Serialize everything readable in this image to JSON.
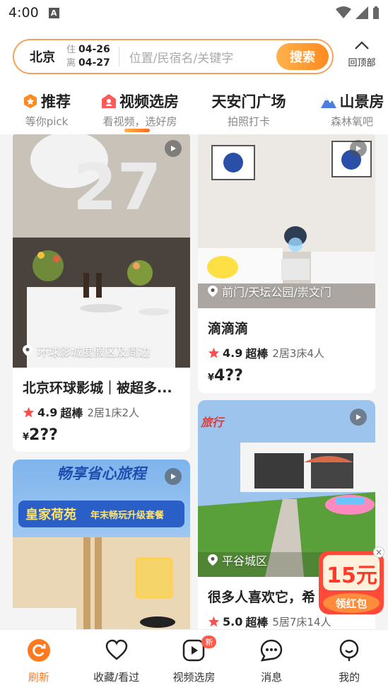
{
  "status_bar": {
    "time": "4:00",
    "notification_icon": "A"
  },
  "search": {
    "city": "北京",
    "checkin_label": "住",
    "checkin_date": "04-26",
    "checkout_label": "离",
    "checkout_date": "04-27",
    "placeholder": "位置/民宿名/关键字",
    "button_label": "搜索",
    "back_top_label": "回顶部"
  },
  "tabs": [
    {
      "title": "推荐",
      "subtitle": "等你pick",
      "icon": "star-badge-icon"
    },
    {
      "title": "视频选房",
      "subtitle": "看视频，选好房",
      "icon": "house-icon",
      "active": true
    },
    {
      "title": "天安门广场",
      "subtitle": "拍照打卡"
    },
    {
      "title": "山景房",
      "subtitle": "森林氧吧",
      "icon": "mountain-icon"
    }
  ],
  "listings": [
    {
      "location": "环球影城度假区及周边",
      "title": "北京环球影城｜被超多...",
      "score": "4.9",
      "level": "超棒",
      "rooms": "2居1床2人",
      "currency": "¥",
      "price": "2??"
    },
    {
      "location": "前门/天坛公园/崇文门",
      "title": "滴滴滴",
      "score": "4.9",
      "level": "超棒",
      "rooms": "2居3床4人",
      "currency": "¥",
      "price": "4??"
    },
    {
      "banner_title": "畅享省心旅程",
      "banner_brand": "皇家荷苑",
      "banner_tag": "年末畅玩升级套餐"
    },
    {
      "location": "平谷城区",
      "title": "很多人喜欢它，希",
      "score": "5.0",
      "level": "超棒",
      "rooms": "5居7床14人",
      "overlay_text": "旅行"
    }
  ],
  "red_packet": {
    "amount": "15元",
    "label": "领红包"
  },
  "bottom_nav": [
    {
      "label": "刷新",
      "icon": "refresh-icon",
      "active": true
    },
    {
      "label": "收藏/看过",
      "icon": "heart-icon"
    },
    {
      "label": "视频选房",
      "icon": "video-icon",
      "badge": "新"
    },
    {
      "label": "消息",
      "icon": "message-icon"
    },
    {
      "label": "我的",
      "icon": "profile-icon"
    }
  ],
  "colors": {
    "accent": "#ff8a1f",
    "star": "#ff4d4d"
  }
}
